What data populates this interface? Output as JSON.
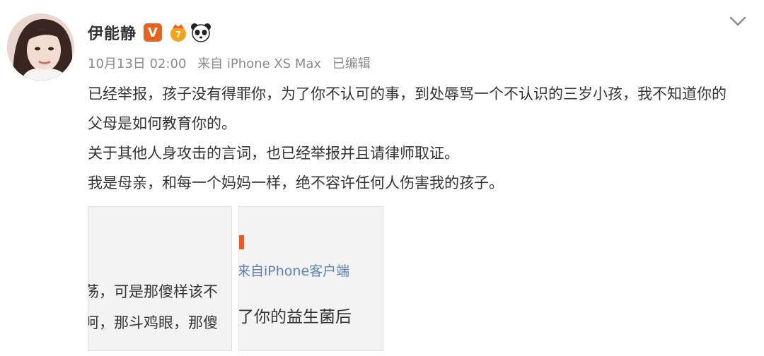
{
  "user": {
    "name": "伊能静",
    "vip_badge": "V",
    "avatar_icon": "avatar-photo",
    "medal_icon": "medal-icon",
    "panda_icon": "panda-icon"
  },
  "post_meta": {
    "date_time": "10月13日 02:00",
    "source": "来自 iPhone XS Max",
    "edited": "已编辑"
  },
  "post": {
    "paragraphs": [
      "已经举报，孩子没有得罪你，为了你不认可的事，到处辱骂一个不认识的三岁小孩，我不知道你的父母是如何教育你的。",
      "关于其他人身攻击的言词，也已经举报并且请律师取证。",
      "我是母亲，和每一个妈妈一样，绝不容许任何人伤害我的孩子。"
    ]
  },
  "thumbnails": [
    {
      "line1": "荡，可是那傻样该不",
      "line2": "呵，那斗鸡眼，那傻"
    },
    {
      "source_line": "来自iPhone客户端",
      "line2": "了你的益生菌后"
    }
  ],
  "colors": {
    "text": "#333333",
    "meta": "#8a8a8a",
    "vip_orange": "#e5631d",
    "link_blue": "#5d7fb8",
    "accent_bar": "#f05a21"
  }
}
